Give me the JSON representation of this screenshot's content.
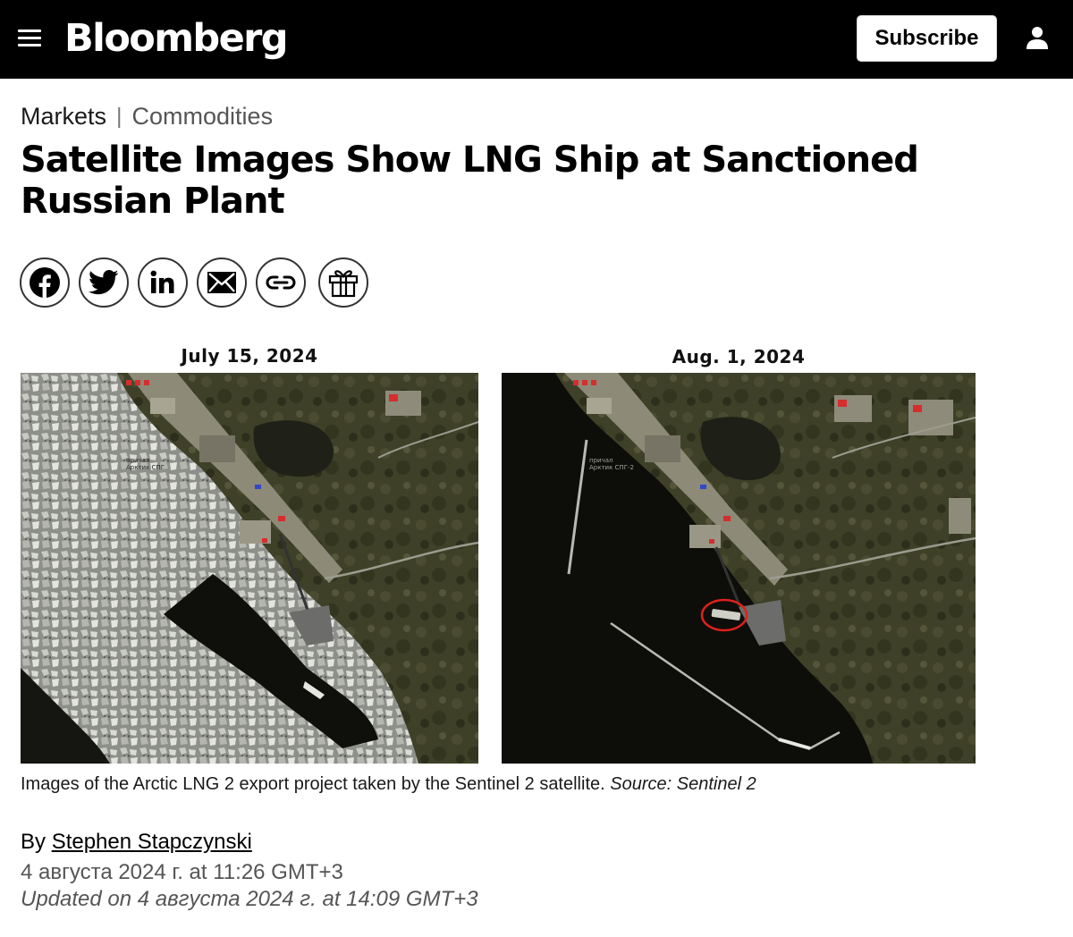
{
  "header": {
    "logo": "Bloomberg",
    "subscribe_label": "Subscribe"
  },
  "breadcrumb": {
    "section": "Markets",
    "separator": "|",
    "subsection": "Commodities"
  },
  "article": {
    "headline": "Satellite Images Show LNG Ship at Sanctioned Russian Plant",
    "share_icons": [
      "facebook-icon",
      "twitter-icon",
      "linkedin-icon",
      "email-icon",
      "link-icon",
      "gift-icon"
    ],
    "figure": {
      "left_title": "July 15, 2024",
      "right_title": "Aug. 1, 2024",
      "map_label_line1": "причал",
      "map_label_line2_left": "Арктик СПГ",
      "map_label_line2_right": "Арктик СПГ-2",
      "caption_text": "Images of the Arctic LNG 2 export project taken by the Sentinel 2 satellite. ",
      "caption_source": "Source: Sentinel 2",
      "highlight_color": "#e0201b"
    },
    "byline_prefix": "By ",
    "author": "Stephen Stapczynski",
    "published": "4 августа 2024 г. at 11:26 GMT+3",
    "updated": "Updated on 4 августа 2024 г. at 14:09 GMT+3"
  }
}
